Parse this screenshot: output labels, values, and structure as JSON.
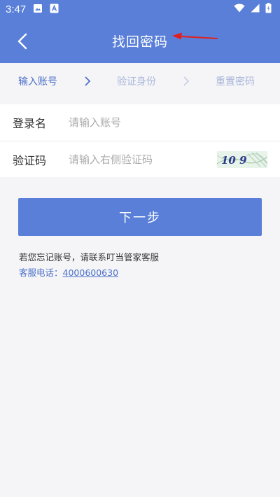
{
  "status_bar": {
    "time": "3:47",
    "icons": [
      "image-icon",
      "app-notification-icon",
      "wifi-icon",
      "signal-icon",
      "battery-icon"
    ]
  },
  "header": {
    "title": "找回密码",
    "back_icon": "back-chevron-icon",
    "background": "#5a7fd8"
  },
  "steps": [
    {
      "label": "输入账号",
      "active": true
    },
    {
      "label": "验证身份",
      "active": false
    },
    {
      "label": "重置密码",
      "active": false
    }
  ],
  "form": {
    "username": {
      "label": "登录名",
      "placeholder": "请输入账号",
      "value": ""
    },
    "captcha": {
      "label": "验证码",
      "placeholder": "请输入右侧验证码",
      "value": "",
      "image_text": "10 9"
    }
  },
  "next_button": {
    "label": "下一步"
  },
  "help": {
    "forgot_text": "若您忘记账号，请联系叮当管家客服",
    "service_label": "客服电话：",
    "service_phone": "4000600630"
  },
  "colors": {
    "accent": "#5a7fd8",
    "link": "#4a6fc9",
    "annotation_arrow": "#e02020"
  }
}
